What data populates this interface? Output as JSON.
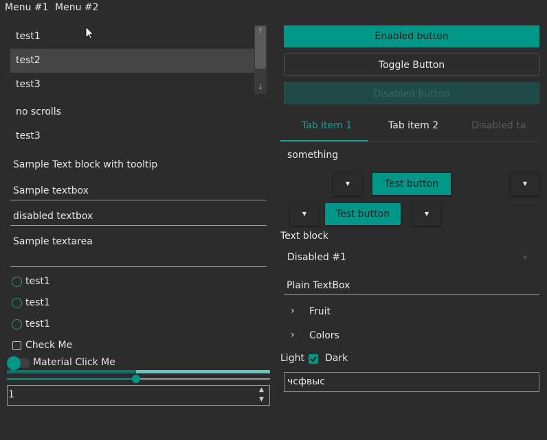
{
  "menu": {
    "item1": "Menu #1",
    "item2": "Menu #2"
  },
  "listbox": {
    "items": [
      "test1",
      "test2",
      "test3"
    ],
    "selected": "test2"
  },
  "list_no_scroll": {
    "items": [
      "no scrolls",
      "test3"
    ]
  },
  "text_block_tooltip": "Sample Text block with tooltip",
  "textbox": {
    "value": "Sample textbox"
  },
  "textbox_disabled": {
    "value": "disabled textbox"
  },
  "textarea": {
    "value": "Sample textarea"
  },
  "radios": [
    "test1",
    "test1",
    "test1"
  ],
  "checkbox": {
    "label": "Check Me",
    "checked": false
  },
  "toggle": {
    "label": "Material Click Me",
    "checked": false
  },
  "progress": {
    "value": 0.49
  },
  "slider": {
    "value": 0.49
  },
  "numeric": {
    "value": "1"
  },
  "buttons": {
    "enabled": "Enabled button",
    "toggle": "Toggle Button",
    "disabled": "Disabled button"
  },
  "tabs": {
    "items": [
      "Tab item 1",
      "Tab item 2",
      "Disabled tab"
    ],
    "selected": 0
  },
  "tab_content": "something",
  "test_button_1": "Test button",
  "test_button_2": "Test button",
  "text_block": "Text block",
  "combobox_disabled": {
    "value": "Disabled #1"
  },
  "plain_textbox": {
    "value": "Plain TextBox"
  },
  "tree": {
    "items": [
      "Fruit",
      "Colors"
    ]
  },
  "theme": {
    "light": "Light",
    "dark": "Dark",
    "checked": true
  },
  "input_box": {
    "value": "чсфвыс"
  },
  "colors": {
    "accent": "#009688",
    "bg": "#2c2c2c"
  }
}
